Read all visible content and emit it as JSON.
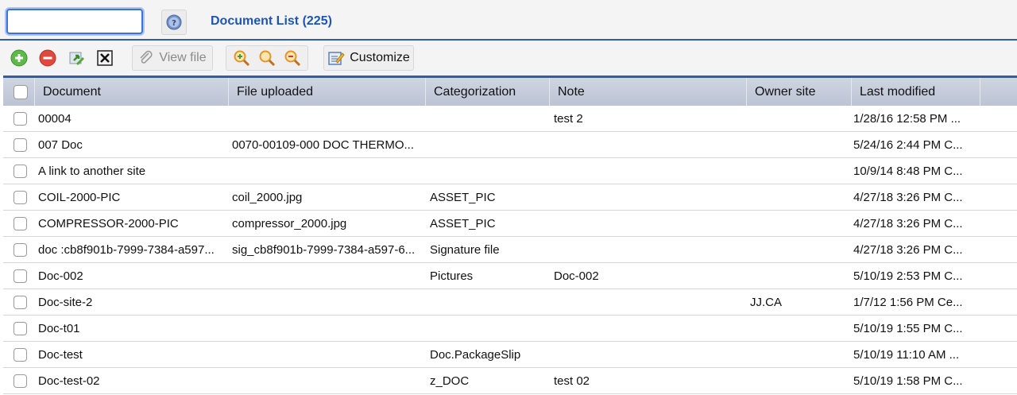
{
  "search": {
    "value": "",
    "placeholder": ""
  },
  "header": {
    "title": "Document List (225)"
  },
  "toolbar": {
    "add_icon": "add-icon",
    "delete_icon": "remove-icon",
    "view_file_label": "View file",
    "customize_label": "Customize"
  },
  "table": {
    "columns": [
      "Document",
      "File uploaded",
      "Categorization",
      "Note",
      "Owner site",
      "Last modified"
    ],
    "rows": [
      {
        "document": "00004",
        "file": "",
        "category": "",
        "note": "test 2",
        "owner": "",
        "modified": "1/28/16 12:58 PM ..."
      },
      {
        "document": "007 Doc",
        "file": "0070-00109-000 DOC THERMO...",
        "category": "",
        "note": "",
        "owner": "",
        "modified": "5/24/16 2:44 PM C..."
      },
      {
        "document": "A link to another site",
        "file": "",
        "category": "",
        "note": "",
        "owner": "",
        "modified": "10/9/14 8:48 PM C..."
      },
      {
        "document": "COIL-2000-PIC",
        "file": "coil_2000.jpg",
        "category": "ASSET_PIC",
        "note": "",
        "owner": "",
        "modified": "4/27/18 3:26 PM C..."
      },
      {
        "document": "COMPRESSOR-2000-PIC",
        "file": "compressor_2000.jpg",
        "category": "ASSET_PIC",
        "note": "",
        "owner": "",
        "modified": "4/27/18 3:26 PM C..."
      },
      {
        "document": "doc :cb8f901b-7999-7384-a597...",
        "file": "sig_cb8f901b-7999-7384-a597-6...",
        "category": "Signature file",
        "note": "",
        "owner": "",
        "modified": "4/27/18 3:26 PM C..."
      },
      {
        "document": "Doc-002",
        "file": "",
        "category": "Pictures",
        "note": "Doc-002",
        "owner": "",
        "modified": "5/10/19 2:53 PM C..."
      },
      {
        "document": "Doc-site-2",
        "file": "",
        "category": "",
        "note": "",
        "owner": "JJ.CA",
        "modified": "1/7/12 1:56 PM Ce..."
      },
      {
        "document": "Doc-t01",
        "file": "",
        "category": "",
        "note": "",
        "owner": "",
        "modified": "5/10/19 1:55 PM C..."
      },
      {
        "document": "Doc-test",
        "file": "",
        "category": "Doc.PackageSlip",
        "note": "",
        "owner": "",
        "modified": "5/10/19 11:10 AM ..."
      },
      {
        "document": "Doc-test-02",
        "file": "",
        "category": "z_DOC",
        "note": "test 02",
        "owner": "",
        "modified": "5/10/19 1:58 PM C..."
      }
    ]
  }
}
